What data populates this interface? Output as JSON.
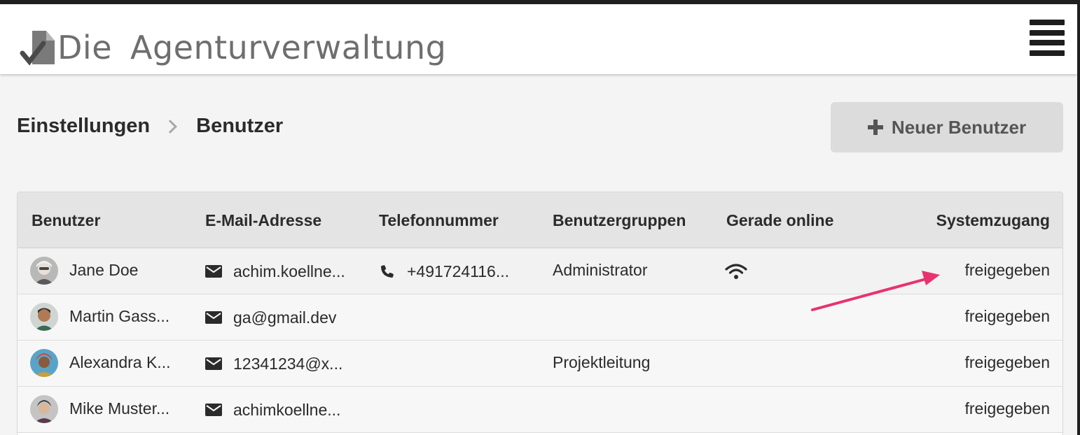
{
  "header": {
    "logo_text_1": "Die",
    "logo_text_2": "Agenturverwaltung",
    "menu_icon": "hamburger-menu-icon"
  },
  "breadcrumb": {
    "parent": "Einstellungen",
    "current": "Benutzer"
  },
  "actions": {
    "new_user_label": "Neuer Benutzer",
    "new_user_icon": "plus-icon"
  },
  "table": {
    "columns": {
      "user": "Benutzer",
      "email": "E-Mail-Adresse",
      "phone": "Telefonnummer",
      "groups": "Benutzergruppen",
      "online": "Gerade online",
      "access": "Systemzugang"
    },
    "rows": [
      {
        "name": "Jane Doe",
        "email": "achim.koellne...",
        "phone": "+491724116...",
        "group": "Administrator",
        "online": "wifi-icon",
        "access": "freigegeben"
      },
      {
        "name": "Martin Gass...",
        "email": "ga@gmail.dev",
        "phone": "",
        "group": "",
        "online": "",
        "access": "freigegeben"
      },
      {
        "name": "Alexandra K...",
        "email": "12341234@x...",
        "phone": "",
        "group": "Projektleitung",
        "online": "",
        "access": "freigegeben"
      },
      {
        "name": "Mike Muster...",
        "email": "achimkoellne...",
        "phone": "",
        "group": "",
        "online": "",
        "access": "freigegeben"
      }
    ]
  },
  "colors": {
    "annotation_arrow": "#e8336e",
    "button_bg": "#dcdcdc",
    "header_row_bg": "#e4e4e4"
  }
}
